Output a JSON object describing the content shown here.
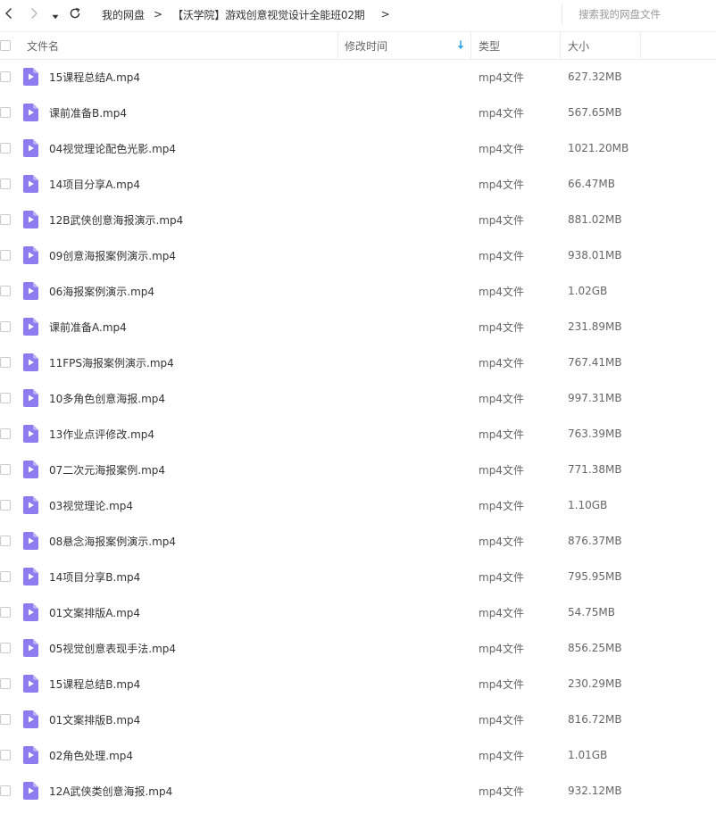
{
  "toolbar": {
    "back_icon": "chevron-left-icon",
    "forward_icon": "chevron-right-icon",
    "dropdown_icon": "caret-down-icon",
    "refresh_icon": "refresh-icon"
  },
  "breadcrumb": {
    "home": "我的网盘",
    "separator": ">",
    "current": "【沃学院】游戏创意视觉设计全能班02期",
    "trailing_separator": ">"
  },
  "search": {
    "placeholder": "搜索我的网盘文件",
    "value": ""
  },
  "table": {
    "headers": {
      "name": "文件名",
      "mtime": "修改时间",
      "type": "类型",
      "size": "大小"
    },
    "sort_column": "mtime",
    "sort_direction": "desc",
    "colors": {
      "file_icon": "#8c7cf0",
      "sort_arrow": "#2aa1e6"
    },
    "rows": [
      {
        "name": "15课程总结A.mp4",
        "type": "mp4文件",
        "size": "627.32MB"
      },
      {
        "name": "课前准备B.mp4",
        "type": "mp4文件",
        "size": "567.65MB"
      },
      {
        "name": "04视觉理论配色光影.mp4",
        "type": "mp4文件",
        "size": "1021.20MB"
      },
      {
        "name": "14项目分享A.mp4",
        "type": "mp4文件",
        "size": "66.47MB"
      },
      {
        "name": "12B武侠创意海报演示.mp4",
        "type": "mp4文件",
        "size": "881.02MB"
      },
      {
        "name": "09创意海报案例演示.mp4",
        "type": "mp4文件",
        "size": "938.01MB"
      },
      {
        "name": "06海报案例演示.mp4",
        "type": "mp4文件",
        "size": "1.02GB"
      },
      {
        "name": "课前准备A.mp4",
        "type": "mp4文件",
        "size": "231.89MB"
      },
      {
        "name": "11FPS海报案例演示.mp4",
        "type": "mp4文件",
        "size": "767.41MB"
      },
      {
        "name": "10多角色创意海报.mp4",
        "type": "mp4文件",
        "size": "997.31MB"
      },
      {
        "name": "13作业点评修改.mp4",
        "type": "mp4文件",
        "size": "763.39MB"
      },
      {
        "name": "07二次元海报案例.mp4",
        "type": "mp4文件",
        "size": "771.38MB"
      },
      {
        "name": "03视觉理论.mp4",
        "type": "mp4文件",
        "size": "1.10GB"
      },
      {
        "name": "08悬念海报案例演示.mp4",
        "type": "mp4文件",
        "size": "876.37MB"
      },
      {
        "name": "14项目分享B.mp4",
        "type": "mp4文件",
        "size": "795.95MB"
      },
      {
        "name": "01文案排版A.mp4",
        "type": "mp4文件",
        "size": "54.75MB"
      },
      {
        "name": "05视觉创意表现手法.mp4",
        "type": "mp4文件",
        "size": "856.25MB"
      },
      {
        "name": "15课程总结B.mp4",
        "type": "mp4文件",
        "size": "230.29MB"
      },
      {
        "name": "01文案排版B.mp4",
        "type": "mp4文件",
        "size": "816.72MB"
      },
      {
        "name": "02角色处理.mp4",
        "type": "mp4文件",
        "size": "1.01GB"
      },
      {
        "name": "12A武侠类创意海报.mp4",
        "type": "mp4文件",
        "size": "932.12MB"
      }
    ]
  }
}
